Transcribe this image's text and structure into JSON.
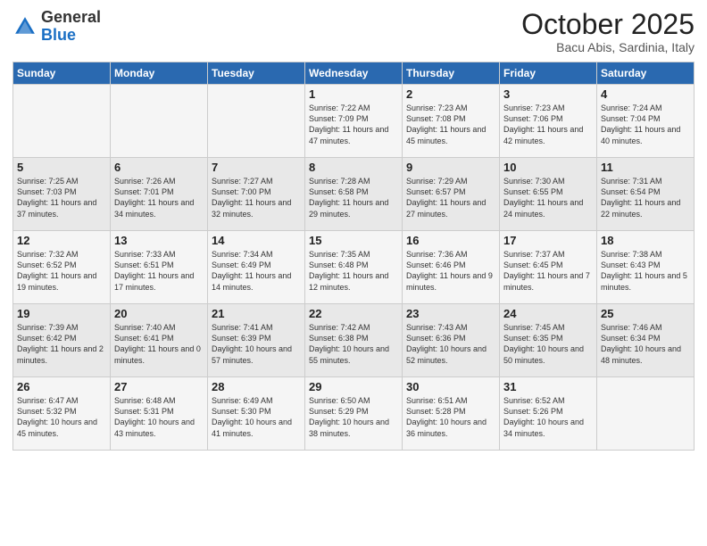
{
  "header": {
    "logo_general": "General",
    "logo_blue": "Blue",
    "month_title": "October 2025",
    "subtitle": "Bacu Abis, Sardinia, Italy"
  },
  "days_of_week": [
    "Sunday",
    "Monday",
    "Tuesday",
    "Wednesday",
    "Thursday",
    "Friday",
    "Saturday"
  ],
  "weeks": [
    [
      {
        "day": "",
        "info": ""
      },
      {
        "day": "",
        "info": ""
      },
      {
        "day": "",
        "info": ""
      },
      {
        "day": "1",
        "info": "Sunrise: 7:22 AM\nSunset: 7:09 PM\nDaylight: 11 hours and 47 minutes."
      },
      {
        "day": "2",
        "info": "Sunrise: 7:23 AM\nSunset: 7:08 PM\nDaylight: 11 hours and 45 minutes."
      },
      {
        "day": "3",
        "info": "Sunrise: 7:23 AM\nSunset: 7:06 PM\nDaylight: 11 hours and 42 minutes."
      },
      {
        "day": "4",
        "info": "Sunrise: 7:24 AM\nSunset: 7:04 PM\nDaylight: 11 hours and 40 minutes."
      }
    ],
    [
      {
        "day": "5",
        "info": "Sunrise: 7:25 AM\nSunset: 7:03 PM\nDaylight: 11 hours and 37 minutes."
      },
      {
        "day": "6",
        "info": "Sunrise: 7:26 AM\nSunset: 7:01 PM\nDaylight: 11 hours and 34 minutes."
      },
      {
        "day": "7",
        "info": "Sunrise: 7:27 AM\nSunset: 7:00 PM\nDaylight: 11 hours and 32 minutes."
      },
      {
        "day": "8",
        "info": "Sunrise: 7:28 AM\nSunset: 6:58 PM\nDaylight: 11 hours and 29 minutes."
      },
      {
        "day": "9",
        "info": "Sunrise: 7:29 AM\nSunset: 6:57 PM\nDaylight: 11 hours and 27 minutes."
      },
      {
        "day": "10",
        "info": "Sunrise: 7:30 AM\nSunset: 6:55 PM\nDaylight: 11 hours and 24 minutes."
      },
      {
        "day": "11",
        "info": "Sunrise: 7:31 AM\nSunset: 6:54 PM\nDaylight: 11 hours and 22 minutes."
      }
    ],
    [
      {
        "day": "12",
        "info": "Sunrise: 7:32 AM\nSunset: 6:52 PM\nDaylight: 11 hours and 19 minutes."
      },
      {
        "day": "13",
        "info": "Sunrise: 7:33 AM\nSunset: 6:51 PM\nDaylight: 11 hours and 17 minutes."
      },
      {
        "day": "14",
        "info": "Sunrise: 7:34 AM\nSunset: 6:49 PM\nDaylight: 11 hours and 14 minutes."
      },
      {
        "day": "15",
        "info": "Sunrise: 7:35 AM\nSunset: 6:48 PM\nDaylight: 11 hours and 12 minutes."
      },
      {
        "day": "16",
        "info": "Sunrise: 7:36 AM\nSunset: 6:46 PM\nDaylight: 11 hours and 9 minutes."
      },
      {
        "day": "17",
        "info": "Sunrise: 7:37 AM\nSunset: 6:45 PM\nDaylight: 11 hours and 7 minutes."
      },
      {
        "day": "18",
        "info": "Sunrise: 7:38 AM\nSunset: 6:43 PM\nDaylight: 11 hours and 5 minutes."
      }
    ],
    [
      {
        "day": "19",
        "info": "Sunrise: 7:39 AM\nSunset: 6:42 PM\nDaylight: 11 hours and 2 minutes."
      },
      {
        "day": "20",
        "info": "Sunrise: 7:40 AM\nSunset: 6:41 PM\nDaylight: 11 hours and 0 minutes."
      },
      {
        "day": "21",
        "info": "Sunrise: 7:41 AM\nSunset: 6:39 PM\nDaylight: 10 hours and 57 minutes."
      },
      {
        "day": "22",
        "info": "Sunrise: 7:42 AM\nSunset: 6:38 PM\nDaylight: 10 hours and 55 minutes."
      },
      {
        "day": "23",
        "info": "Sunrise: 7:43 AM\nSunset: 6:36 PM\nDaylight: 10 hours and 52 minutes."
      },
      {
        "day": "24",
        "info": "Sunrise: 7:45 AM\nSunset: 6:35 PM\nDaylight: 10 hours and 50 minutes."
      },
      {
        "day": "25",
        "info": "Sunrise: 7:46 AM\nSunset: 6:34 PM\nDaylight: 10 hours and 48 minutes."
      }
    ],
    [
      {
        "day": "26",
        "info": "Sunrise: 6:47 AM\nSunset: 5:32 PM\nDaylight: 10 hours and 45 minutes."
      },
      {
        "day": "27",
        "info": "Sunrise: 6:48 AM\nSunset: 5:31 PM\nDaylight: 10 hours and 43 minutes."
      },
      {
        "day": "28",
        "info": "Sunrise: 6:49 AM\nSunset: 5:30 PM\nDaylight: 10 hours and 41 minutes."
      },
      {
        "day": "29",
        "info": "Sunrise: 6:50 AM\nSunset: 5:29 PM\nDaylight: 10 hours and 38 minutes."
      },
      {
        "day": "30",
        "info": "Sunrise: 6:51 AM\nSunset: 5:28 PM\nDaylight: 10 hours and 36 minutes."
      },
      {
        "day": "31",
        "info": "Sunrise: 6:52 AM\nSunset: 5:26 PM\nDaylight: 10 hours and 34 minutes."
      },
      {
        "day": "",
        "info": ""
      }
    ]
  ]
}
